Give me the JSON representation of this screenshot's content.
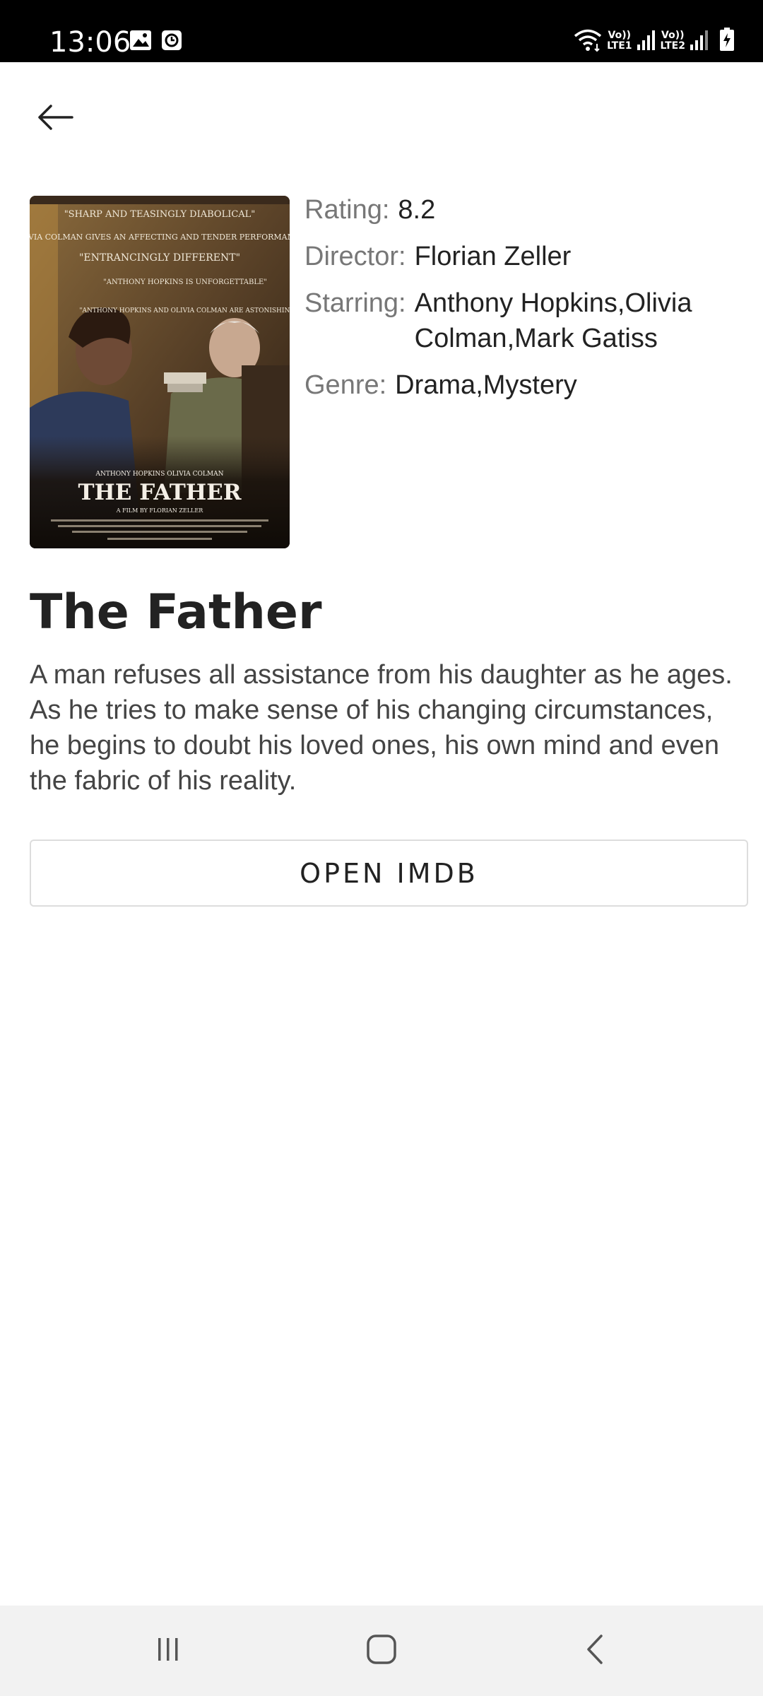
{
  "status_bar": {
    "time": "13:06",
    "icons": [
      "gallery-icon",
      "alarm-icon",
      "wifi-icon",
      "signal-icon",
      "battery-icon"
    ],
    "sim1_top": "Vo))",
    "sim1_bottom": "LTE1",
    "sim2_top": "Vo))",
    "sim2_bottom": "LTE2"
  },
  "toolbar": {
    "back_icon": "arrow-left-icon"
  },
  "movie": {
    "poster": {
      "title_text": "THE FATHER",
      "actors_text": "ANTHONY HOPKINS   OLIVIA COLMAN",
      "director_text": "A FILM BY FLORIAN ZELLER",
      "quotes": [
        "\"SHARP AND TEASINGLY DIABOLICAL\"",
        "\"OLIVIA COLMAN GIVES AN AFFECTING AND TENDER PERFORMANCE\"",
        "\"ENTRANCINGLY DIFFERENT\"",
        "\"ANTHONY HOPKINS IS UNFORGETTABLE\"",
        "\"ANTHONY HOPKINS AND OLIVIA COLMAN ARE ASTONISHING\""
      ]
    },
    "rating_label": "Rating:",
    "rating_value": "8.2",
    "director_label": "Director:",
    "director_value": "Florian Zeller",
    "starring_label": "Starring:",
    "starring_value": "Anthony Hopkins,Olivia Colman,Mark Gatiss",
    "genre_label": "Genre:",
    "genre_value": "Drama,Mystery",
    "title": "The Father",
    "synopsis": "A man refuses all assistance from his daughter as he ages. As he tries to make sense of his changing circumstances, he begins to doubt his loved ones, his own mind and even the fabric of his reality.",
    "open_button_label": "OPEN IMDB"
  },
  "nav_bar": {
    "recents_icon": "recents-icon",
    "home_icon": "home-icon",
    "back_icon": "nav-back-icon"
  }
}
